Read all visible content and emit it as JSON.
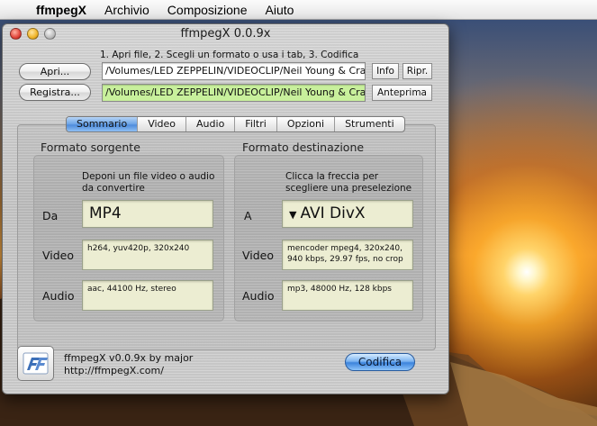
{
  "menubar": {
    "app_name": "ffmpegX",
    "items": [
      "Archivio",
      "Composizione",
      "Aiuto"
    ]
  },
  "window": {
    "title": "ffmpegX 0.0.9x"
  },
  "instructions": "1. Apri file, 2. Scegli un formato o usa i tab, 3. Codifica",
  "open": {
    "button_label": "Apri...",
    "path": "/Volumes/LED ZEPPELIN/VIDEOCLIP/Neil Young & Cra",
    "info_label": "Info",
    "play_label": "Ripr."
  },
  "save": {
    "button_label": "Registra...",
    "path": "/Volumes/LED ZEPPELIN/VIDEOCLIP/Neil Young & Cra",
    "preview_label": "Anteprima"
  },
  "tabs": [
    {
      "label": "Sommario",
      "active": true
    },
    {
      "label": "Video",
      "active": false
    },
    {
      "label": "Audio",
      "active": false
    },
    {
      "label": "Filtri",
      "active": false
    },
    {
      "label": "Opzioni",
      "active": false
    },
    {
      "label": "Strumenti",
      "active": false
    }
  ],
  "source": {
    "title": "Formato sorgente",
    "hint": "Deponi un file video o audio da convertire",
    "format_label": "Da",
    "format_value": "MP4",
    "video_label": "Video",
    "video_value": "h264, yuv420p, 320x240",
    "audio_label": "Audio",
    "audio_value": "aac, 44100 Hz, stereo"
  },
  "destination": {
    "title": "Formato destinazione",
    "hint": "Clicca la freccia per scegliere una preselezione",
    "format_label": "A",
    "format_value": "AVI DivX",
    "format_chevron": "▼",
    "video_label": "Video",
    "video_value": "mencoder mpeg4, 320x240, 940 kbps, 29.97 fps, no crop",
    "audio_label": "Audio",
    "audio_value": "mp3, 48000 Hz, 128 kbps"
  },
  "footer": {
    "version_line": "ffmpegX v0.0.9x by major",
    "url_line": "http://ffmpegX.com/",
    "encode_label": "Codifica"
  },
  "colors": {
    "accent_blue": "#4d8bdb",
    "field_green": "#c8f09c",
    "value_box": "#ecedd2"
  }
}
